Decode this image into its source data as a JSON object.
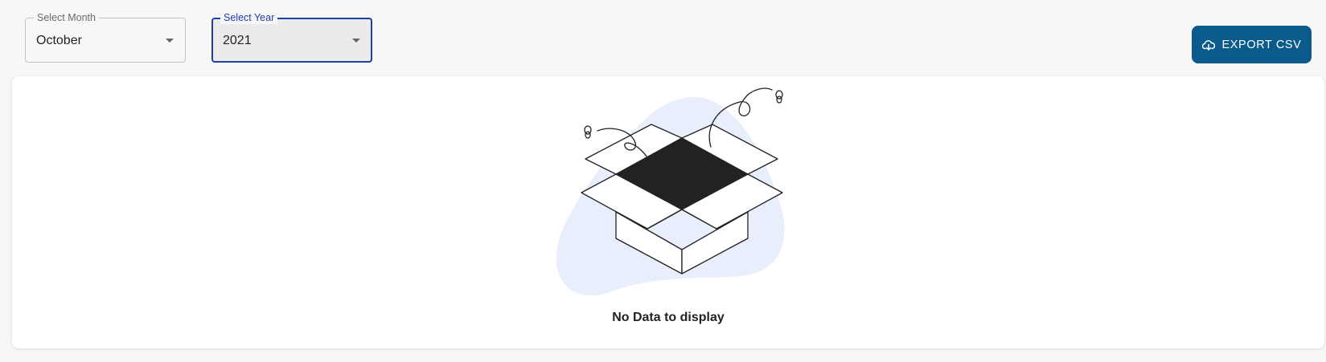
{
  "filters": {
    "month": {
      "label": "Select Month",
      "value": "October"
    },
    "year": {
      "label": "Select Year",
      "value": "2021"
    }
  },
  "actions": {
    "export_label": "EXPORT CSV",
    "export_icon": "cloud-download-icon"
  },
  "empty_state": {
    "message": "No Data to display",
    "illustration": "empty-box-icon"
  },
  "colors": {
    "primary": "#0b5a8c",
    "focus": "#1c3fa8",
    "blob": "#e8eefc"
  }
}
